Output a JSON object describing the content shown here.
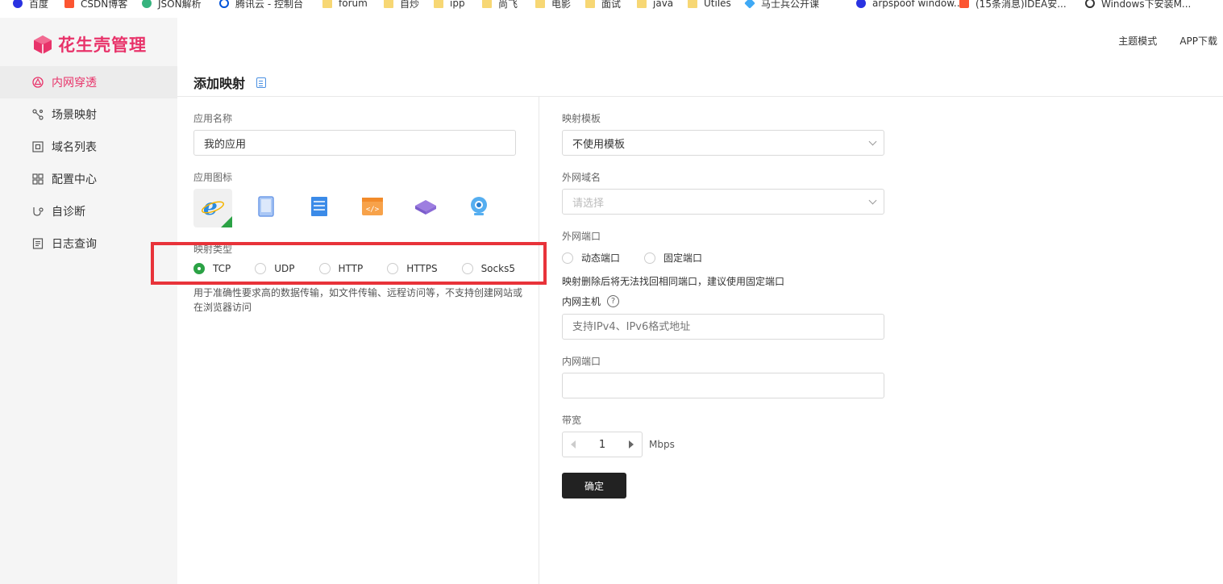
{
  "bookmarks": [
    {
      "label": "百度",
      "icon": "baidu-icon"
    },
    {
      "label": "CSDN博客",
      "icon": "csdn-icon"
    },
    {
      "label": "JSON解析",
      "icon": "json-icon"
    },
    {
      "label": "腾讯云 - 控制台",
      "icon": "cloud-icon"
    },
    {
      "label": "forum",
      "icon": "folder-icon"
    },
    {
      "label": "自炒",
      "icon": "folder-icon"
    },
    {
      "label": "ipp",
      "icon": "folder-icon"
    },
    {
      "label": "尚飞",
      "icon": "folder-icon"
    },
    {
      "label": "电影",
      "icon": "folder-icon"
    },
    {
      "label": "面试",
      "icon": "folder-icon"
    },
    {
      "label": "java",
      "icon": "folder-icon"
    },
    {
      "label": "Utiles",
      "icon": "folder-icon"
    },
    {
      "label": "马士兵公开课",
      "icon": "diamond-icon"
    },
    {
      "label": "arpspoof window...",
      "icon": "baidu-icon"
    },
    {
      "label": "(15条消息)IDEA安...",
      "icon": "csdn-icon"
    },
    {
      "label": "Windows下安装M...",
      "icon": "github-icon"
    }
  ],
  "logo": {
    "text": "花生壳管理"
  },
  "topbar": {
    "theme": "主题模式",
    "app": "APP下载"
  },
  "sidebar": {
    "items": [
      {
        "label": "内网穿透",
        "icon": "network-icon",
        "active": true
      },
      {
        "label": "场景映射",
        "icon": "branch-icon",
        "active": false
      },
      {
        "label": "域名列表",
        "icon": "domain-icon",
        "active": false
      },
      {
        "label": "配置中心",
        "icon": "grid-icon",
        "active": false
      },
      {
        "label": "自诊断",
        "icon": "diagnose-icon",
        "active": false
      },
      {
        "label": "日志查询",
        "icon": "log-icon",
        "active": false
      }
    ]
  },
  "page": {
    "title": "添加映射"
  },
  "form": {
    "app_name_label": "应用名称",
    "app_name_value": "我的应用",
    "app_icon_label": "应用图标",
    "app_icons": [
      "ie-icon",
      "tablet-icon",
      "server-icon",
      "code-icon",
      "layers-icon",
      "camera-icon"
    ],
    "map_type_label": "映射类型",
    "map_types": [
      "TCP",
      "UDP",
      "HTTP",
      "HTTPS",
      "Socks5"
    ],
    "map_type_selected": "TCP",
    "map_type_desc": "用于准确性要求高的数据传输，如文件传输、远程访问等，不支持创建网站或在浏览器访问",
    "template_label": "映射模板",
    "template_value": "不使用模板",
    "domain_label": "外网域名",
    "domain_placeholder": "请选择",
    "ext_port_label": "外网端口",
    "ext_port_options": [
      "动态端口",
      "固定端口"
    ],
    "ext_port_hint": "映射删除后将无法找回相同端口，建议使用固定端口",
    "host_label": "内网主机",
    "host_help": "?",
    "host_placeholder": "支持IPv4、IPv6格式地址",
    "int_port_label": "内网端口",
    "int_port_value": "",
    "bandwidth_label": "带宽",
    "bandwidth_value": "1",
    "bandwidth_unit": "Mbps",
    "submit_label": "确定"
  },
  "colors": {
    "brand": "#e8336a",
    "radio_checked": "#2ba245",
    "highlight": "#e8333a",
    "button": "#222222"
  }
}
